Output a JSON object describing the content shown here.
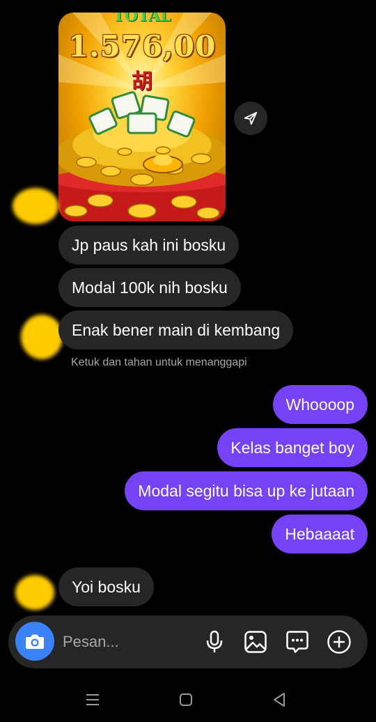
{
  "image_message": {
    "top_text": "TOTAL",
    "amount_text": "1.576,00",
    "character": "胡",
    "icon": "send-icon"
  },
  "incoming_messages": [
    {
      "text": "Jp paus kah ini bosku"
    },
    {
      "text": "Modal 100k nih bosku"
    },
    {
      "text": "Enak bener main di kembang"
    }
  ],
  "reply_hint": "Ketuk dan tahan untuk menanggapi",
  "outgoing_messages": [
    {
      "text": "Whoooop"
    },
    {
      "text": "Kelas banget boy"
    },
    {
      "text": "Modal segitu bisa up ke jutaan"
    },
    {
      "text": "Hebaaaat"
    }
  ],
  "last_incoming": {
    "text": "Yoi bosku"
  },
  "composer": {
    "placeholder": "Pesan...",
    "icons": [
      "camera-icon",
      "microphone-icon",
      "gallery-icon",
      "sticker-icon",
      "plus-icon"
    ]
  },
  "colors": {
    "background": "#000000",
    "incoming_bubble": "#262626",
    "outgoing_bubble": "#7542f5",
    "camera_button": "#3b82f6",
    "avatar_blur": "#ffcc00"
  },
  "navbar": {
    "icons": [
      "menu-icon",
      "home-icon",
      "back-icon"
    ]
  }
}
